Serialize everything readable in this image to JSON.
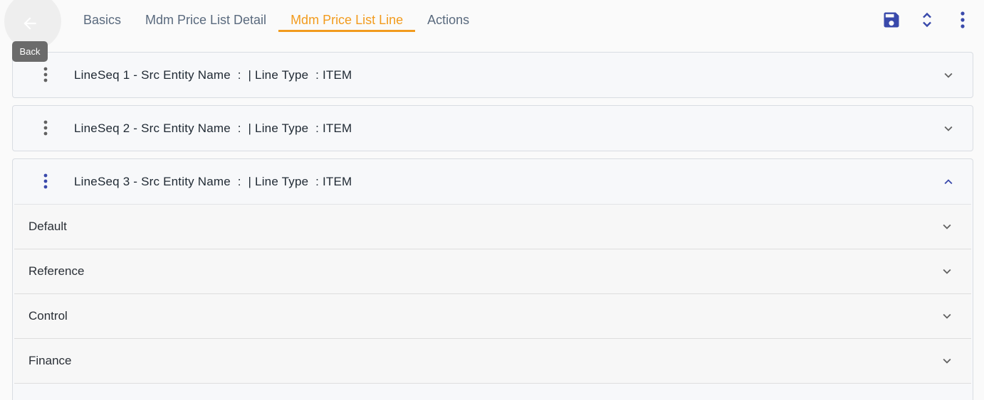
{
  "header": {
    "back_tooltip": "Back",
    "tabs": [
      {
        "label": "Basics"
      },
      {
        "label": "Mdm Price List Detail"
      },
      {
        "label": "Mdm Price List Line"
      },
      {
        "label": "Actions"
      }
    ],
    "active_tab": "Mdm Price List Line",
    "tools": [
      "save-icon",
      "expand-collapse-icon",
      "more-vert-icon"
    ]
  },
  "lines": [
    {
      "title": "LineSeq 1 - Src Entity Name  :  | Line Type  : ITEM",
      "expanded": false
    },
    {
      "title": "LineSeq 2 - Src Entity Name  :  | Line Type  : ITEM",
      "expanded": false
    },
    {
      "title": "LineSeq 3 - Src Entity Name  :  | Line Type  : ITEM",
      "expanded": true
    }
  ],
  "sections": [
    {
      "label": "Default"
    },
    {
      "label": "Reference"
    },
    {
      "label": "Control"
    },
    {
      "label": "Finance"
    }
  ],
  "colors": {
    "accent": "#f29b1d",
    "primary_icon": "#3949ab",
    "tab_text": "#5a6a7e",
    "grey_icon": "#616161"
  }
}
